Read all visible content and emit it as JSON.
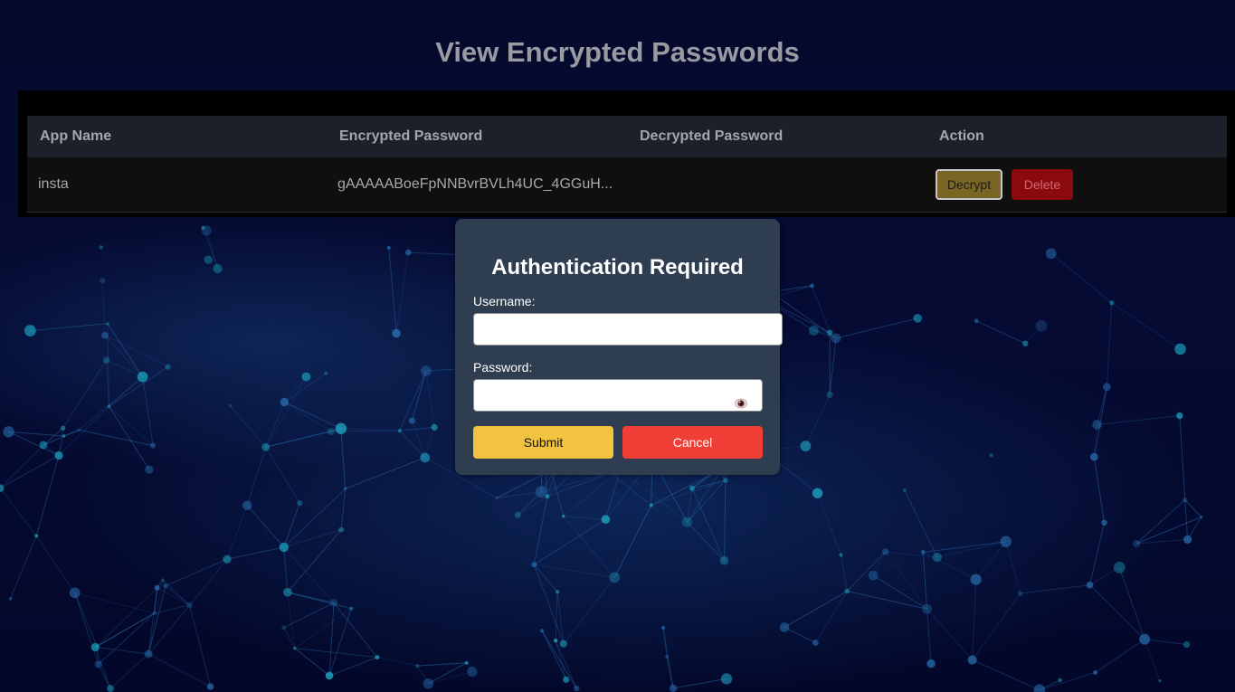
{
  "page": {
    "title": "View Encrypted Passwords"
  },
  "table": {
    "headers": [
      "App Name",
      "Encrypted Password",
      "Decrypted Password",
      "Action"
    ],
    "rows": [
      {
        "app_name": "insta",
        "encrypted_password": "gAAAAABoeFpNNBvrBVLh4UC_4GGuH...",
        "decrypted_password": "",
        "decrypt_label": "Decrypt",
        "delete_label": "Delete"
      }
    ]
  },
  "modal": {
    "title": "Authentication Required",
    "username_label": "Username:",
    "username_value": "",
    "password_label": "Password:",
    "password_value": "",
    "submit_label": "Submit",
    "cancel_label": "Cancel",
    "toggle_icon": "eye-icon"
  },
  "colors": {
    "background": "#04082a",
    "title_text": "#9a9aa3",
    "table_header_bg": "#1c2129",
    "decrypt_button": "#7a6624",
    "delete_button": "#8b0a10",
    "modal_bg": "#2e3d50",
    "submit_button": "#f2c340",
    "cancel_button": "#ef3e35"
  }
}
